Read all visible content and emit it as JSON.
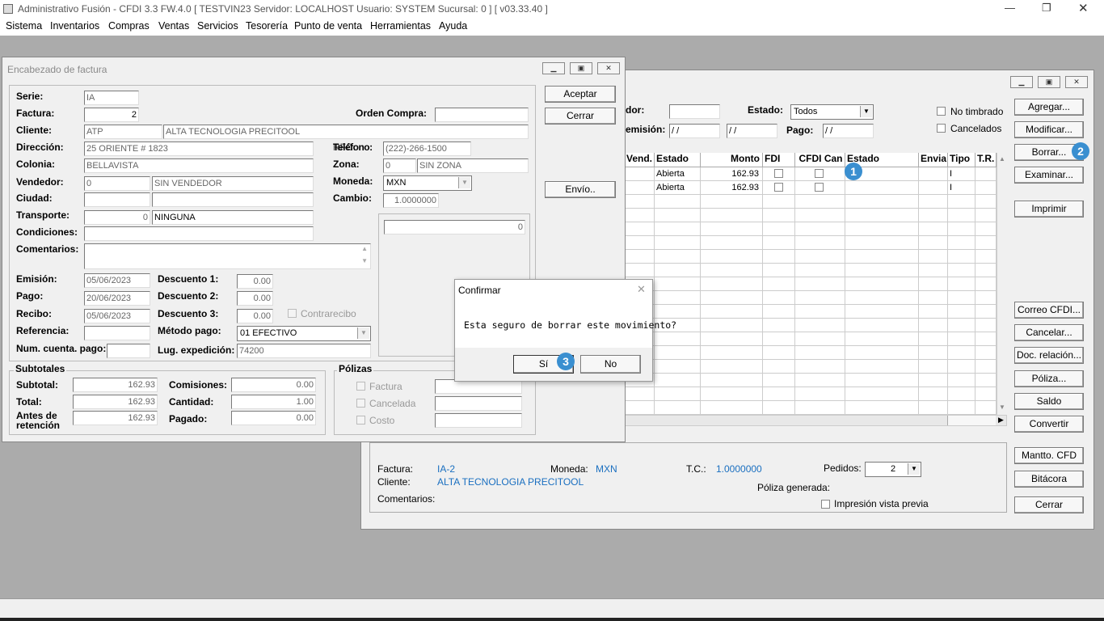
{
  "app": {
    "title": "Administrativo Fusión - CFDI 3.3 FW.4.0 [ TESTVIN23   Servidor: LOCALHOST   Usuario: SYSTEM     Sucursal: 0 ] [ v03.33.40 ]",
    "window_controls": {
      "minimize": "—",
      "restore": "❐",
      "close": "✕"
    }
  },
  "menu": [
    "Sistema",
    "Inventarios",
    "Compras",
    "Ventas",
    "Servicios",
    "Tesorería",
    "Punto de venta",
    "Herramientas",
    "Ayuda"
  ],
  "list_window": {
    "filter": {
      "vendedor_label": "dor:",
      "vendedor_value": "",
      "estado_label": "Estado:",
      "estado_value": "Todos",
      "emision_label": "emisión:",
      "emision_from": " / /",
      "emision_to": " / /",
      "pago_label": "Pago:",
      "pago_value": " / /",
      "no_timbrado": "No timbrado",
      "cancelados": "Cancelados"
    },
    "grid": {
      "headers": [
        "Vend.",
        "Estado",
        "Monto",
        "FDI",
        "CFDI Can",
        "Estado",
        "Envia",
        "Tipo",
        "T.R."
      ],
      "rows": [
        {
          "estado": "Abierta",
          "monto": "162.93",
          "tipo": "I"
        },
        {
          "estado": "Abierta",
          "monto": "162.93",
          "tipo": "I"
        }
      ]
    },
    "buttons": [
      "Agregar...",
      "Modificar...",
      "Borrar...",
      "Examinar...",
      "Imprimir",
      "Correo CFDI...",
      "Cancelar...",
      "Doc. relación...",
      "Póliza...",
      "Saldo",
      "Convertir",
      "Mantto. CFD",
      "Bitácora",
      "Cerrar"
    ],
    "footer": {
      "factura_label": "Factura:",
      "factura_value": "IA-2",
      "moneda_label": "Moneda:",
      "moneda_value": "MXN",
      "tc_label": "T.C.:",
      "tc_value": "1.0000000",
      "pedidos_label": "Pedidos:",
      "pedidos_value": "2",
      "cliente_label": "Cliente:",
      "cliente_value": "ALTA TECNOLOGIA PRECITOOL",
      "poliza_label": "Póliza generada:",
      "comentarios_label": "Comentarios:",
      "vista_previa": "Impresión vista previa"
    }
  },
  "header_window": {
    "title": "Encabezado de factura",
    "fields": {
      "serie_label": "Serie:",
      "serie": "IA",
      "factura_label": "Factura:",
      "factura": "2",
      "orden_label": "Orden Compra:",
      "orden": "",
      "cliente_label": "Cliente:",
      "cliente_code": "ATP",
      "cliente_name": "ALTA TECNOLOGIA PRECITOOL",
      "direccion_label": "Dirección:",
      "direccion": "25 ORIENTE # 1823",
      "telefono_label": "Teléfono:",
      "telefono_overlap": "RFC:",
      "telefono": "(222)-266-1500",
      "colonia_label": "Colonia:",
      "colonia": "BELLAVISTA",
      "zona_label": "Zona:",
      "zona_code": "0",
      "zona_name": "SIN ZONA",
      "vendedor_label": "Vendedor:",
      "vendedor_code": "0",
      "vendedor_name": "SIN VENDEDOR",
      "moneda_label": "Moneda:",
      "moneda": "MXN",
      "ciudad_label": "Ciudad:",
      "cambio_label": "Cambio:",
      "cambio": "1.0000000",
      "transporte_label": "Transporte:",
      "transporte_code": "0",
      "transporte_name": "NINGUNA",
      "condiciones_label": "Condiciones:",
      "comentarios_label": "Comentarios:",
      "side_value": "0",
      "emision_label": "Emisión:",
      "emision": "05/06/2023",
      "pago_label": "Pago:",
      "pago": "20/06/2023",
      "recibo_label": "Recibo:",
      "recibo": "05/06/2023",
      "referencia_label": "Referencia:",
      "numcuenta_label": "Num. cuenta. pago:",
      "desc1_label": "Descuento 1:",
      "desc1": "0.00",
      "desc2_label": "Descuento 2:",
      "desc2": "0.00",
      "desc3_label": "Descuento 3:",
      "desc3": "0.00",
      "contrarecibo": "Contrarecibo",
      "metodo_label": "Método pago:",
      "metodo": "01 EFECTIVO",
      "lugar_label": "Lug. expedición:",
      "lugar": "74200"
    },
    "buttons": {
      "aceptar": "Aceptar",
      "cerrar": "Cerrar",
      "envio": "Envío.."
    },
    "subtotales": {
      "title": "Subtotales",
      "subtotal_label": "Subtotal:",
      "subtotal": "162.93",
      "total_label": "Total:",
      "total": "162.93",
      "antes_label": "Antes de retención",
      "antes": "162.93",
      "comisiones_label": "Comisiones:",
      "comisiones": "0.00",
      "cantidad_label": "Cantidad:",
      "cantidad": "1.00",
      "pagado_label": "Pagado:",
      "pagado": "0.00"
    },
    "polizas": {
      "title": "Pólizas",
      "factura": "Factura",
      "cancelada": "Cancelada",
      "costo": "Costo"
    }
  },
  "dialog": {
    "title": "Confirmar",
    "message": "Esta seguro de borrar este movimiento?",
    "yes": "Sí",
    "no": "No",
    "close": "✕"
  },
  "badges": [
    "1",
    "2",
    "3"
  ],
  "colors": {
    "badge": "#3a8fd0",
    "link": "#1a6fc0"
  }
}
